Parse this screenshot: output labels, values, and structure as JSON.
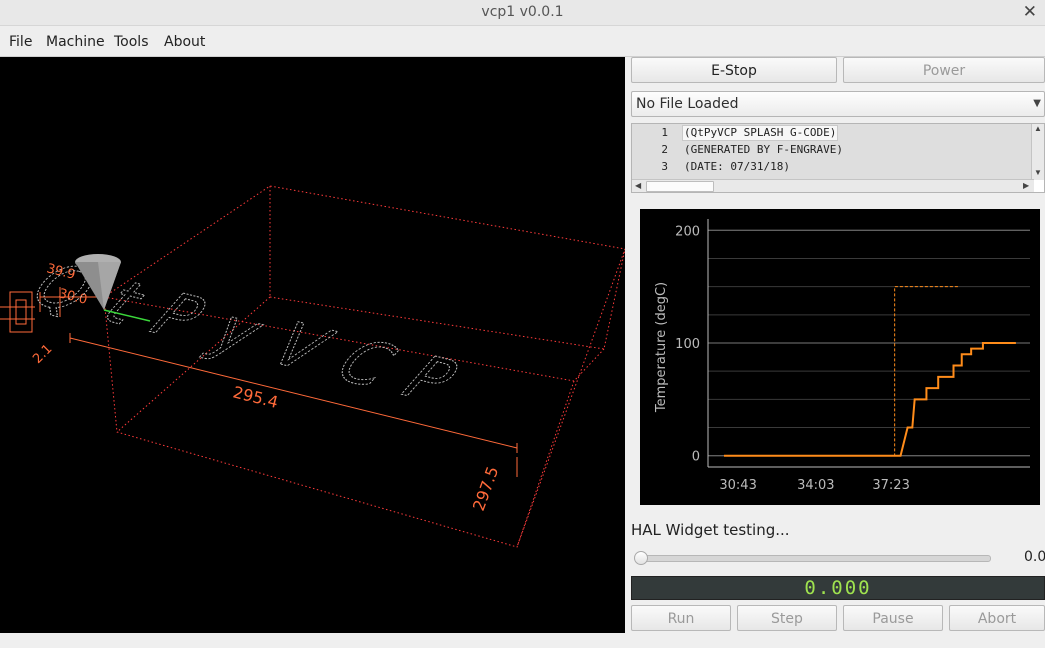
{
  "window": {
    "title": "vcp1 v0.0.1",
    "close_glyph": "✕"
  },
  "menu": [
    {
      "label": "File"
    },
    {
      "label": "Machine"
    },
    {
      "label": "Tools"
    },
    {
      "label": "About"
    }
  ],
  "viewport": {
    "dimensions": {
      "x": "295.4",
      "y": "297.5",
      "z": "2.1",
      "a": "39.9",
      "b": "30.0"
    },
    "engraving_text": "QtPyVCP",
    "colors": {
      "background": "#000000",
      "extents": "#ff3b3b",
      "toolpath": "#bdbdbd",
      "tool": "#9a9a9a"
    }
  },
  "controls": {
    "estop_label": "E-Stop",
    "power_label": "Power",
    "file_combo_value": "No File Loaded",
    "gcode_lines": [
      {
        "num": "1",
        "text": "(QtPyVCP SPLASH G-CODE)"
      },
      {
        "num": "2",
        "text": "(GENERATED BY F-ENGRAVE)"
      },
      {
        "num": "3",
        "text": "(DATE: 07/31/18)"
      }
    ],
    "hal_label": "HAL Widget testing...",
    "slider_value": "0.0",
    "slider_fraction": 0,
    "lcd_value": "0.000",
    "run_label": "Run",
    "step_label": "Step",
    "pause_label": "Pause",
    "abort_label": "Abort"
  },
  "chart_data": {
    "type": "line",
    "title": "",
    "xlabel": "",
    "ylabel": "Temperature (degC)",
    "x_tick_labels": [
      "30:43",
      "34:03",
      "37:23"
    ],
    "y_ticks": [
      0,
      100,
      200
    ],
    "ylim": [
      -10,
      210
    ],
    "grid": true,
    "colors": {
      "actual": "#ff8c1a",
      "setpoint": "#ff8c1a",
      "grid": "#555555",
      "axis": "#bbbbbb"
    },
    "series": [
      {
        "x": [
          0,
          1.5,
          1.56,
          1.6,
          1.62,
          1.72,
          1.72,
          1.82,
          1.82,
          1.95,
          1.95,
          2.02,
          2.02,
          2.1,
          2.1,
          2.2,
          2.2,
          2.48
        ],
        "values": [
          0,
          0,
          25,
          25,
          50,
          50,
          60,
          60,
          70,
          70,
          80,
          80,
          90,
          90,
          95,
          95,
          100,
          100
        ]
      },
      {
        "style": "dashed",
        "x": [
          0,
          1.45,
          1.45,
          2.0
        ],
        "values": [
          0,
          0,
          150,
          150
        ]
      }
    ]
  }
}
